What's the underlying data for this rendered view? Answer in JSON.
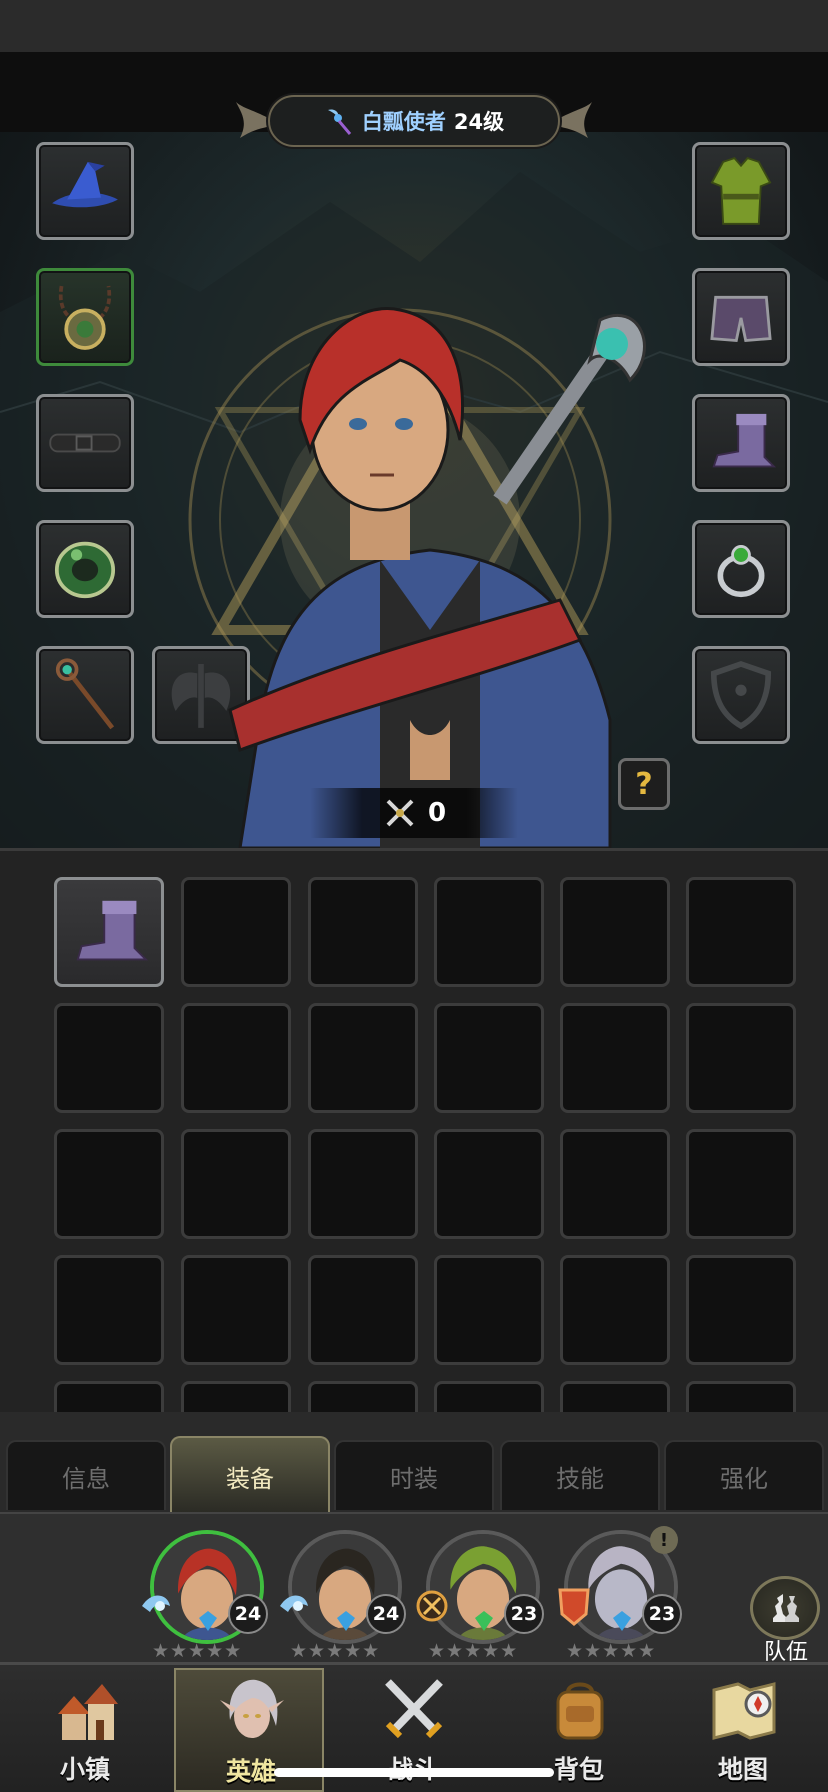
{
  "hero": {
    "name": "白瓢使者",
    "level": "24级",
    "power": "0"
  },
  "equipment_slots_left": [
    {
      "item": "wizard-hat-icon"
    },
    {
      "item": "amulet-icon",
      "highlight": "green"
    },
    {
      "item": "belt-icon"
    },
    {
      "item": "jade-ring-icon"
    },
    {
      "item": "staff-icon"
    }
  ],
  "equipment_slots_right": [
    {
      "item": "green-tunic-icon"
    },
    {
      "item": "shorts-icon"
    },
    {
      "item": "boot-icon"
    },
    {
      "item": "silver-ring-icon"
    },
    {
      "item": "shield-slot-icon"
    }
  ],
  "offhand_slot": {
    "item": "axe-silhouette-icon"
  },
  "help_button": "?",
  "inventory": {
    "rows": 4,
    "cols": 6,
    "items": [
      {
        "index": 0,
        "item": "boot-icon"
      }
    ]
  },
  "tabs": [
    {
      "label": "信息",
      "active": false
    },
    {
      "label": "装备",
      "active": true
    },
    {
      "label": "时装",
      "active": false
    },
    {
      "label": "技能",
      "active": false
    },
    {
      "label": "强化",
      "active": false
    }
  ],
  "party": [
    {
      "level": "24",
      "selected": true,
      "hair": "#b83226",
      "gem": "#3aa0e0",
      "stars": "★★★★★"
    },
    {
      "level": "24",
      "selected": false,
      "hair": "#2a2620",
      "gem": "#3aa0e0",
      "stars": "★★★★★"
    },
    {
      "level": "23",
      "selected": false,
      "hair": "#7aa032",
      "gem": "#3ac05a",
      "stars": "★★★★★"
    },
    {
      "level": "23",
      "selected": false,
      "hair": "#b8b4c4",
      "gem": "#3aa0e0",
      "stars": "★★★★★",
      "alert": "!"
    }
  ],
  "team_button": {
    "label": "队伍"
  },
  "nav": [
    {
      "label": "小镇",
      "icon": "town-icon",
      "active": false
    },
    {
      "label": "英雄",
      "icon": "hero-icon",
      "active": true
    },
    {
      "label": "战斗",
      "icon": "crossed-swords-icon",
      "active": false
    },
    {
      "label": "背包",
      "icon": "backpack-icon",
      "active": false
    },
    {
      "label": "地图",
      "icon": "map-icon",
      "active": false
    }
  ],
  "colors": {
    "hero_name": "#9fd0ff",
    "accent_gold": "#c8a94a",
    "selected_green": "#3fbf3f"
  }
}
